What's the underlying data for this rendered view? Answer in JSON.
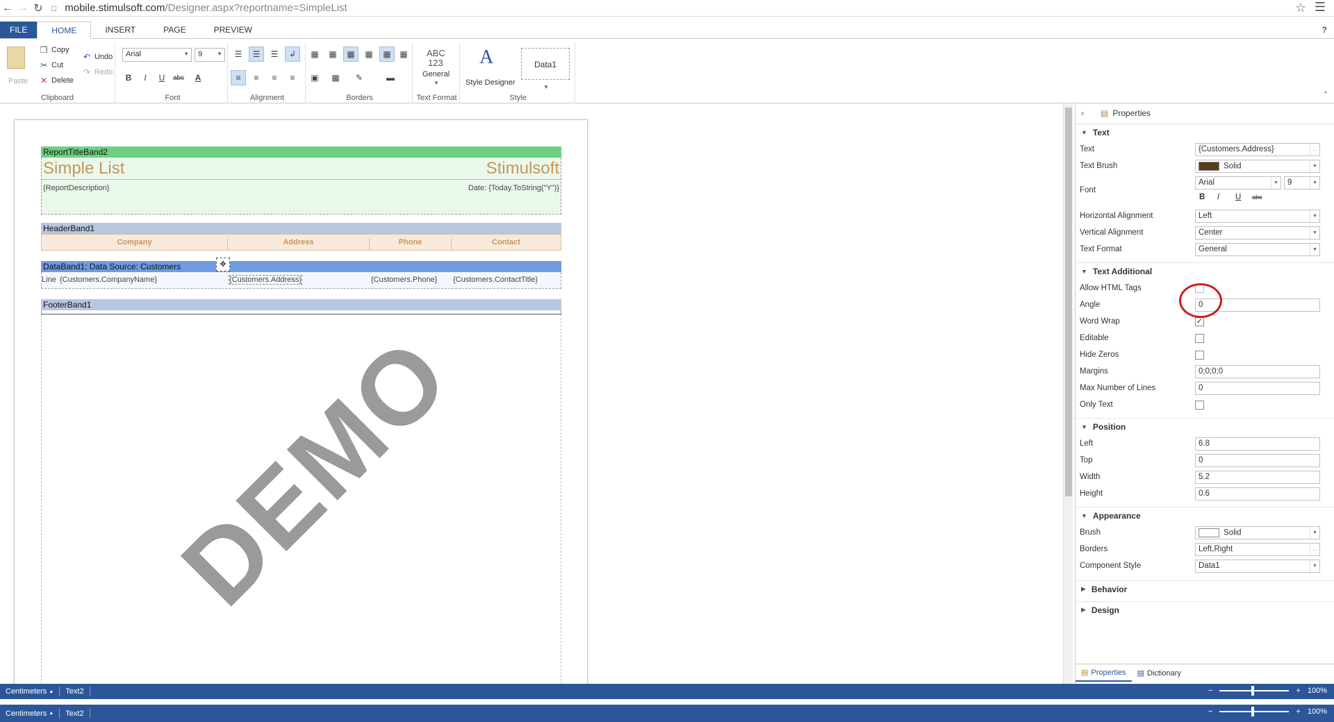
{
  "browser": {
    "url_host": "mobile.stimulsoft.com",
    "url_path": "/Designer.aspx?reportname=SimpleList"
  },
  "ribbon_tabs": [
    "FILE",
    "HOME",
    "INSERT",
    "PAGE",
    "PREVIEW"
  ],
  "active_tab": "HOME",
  "help": "?",
  "clipboard": {
    "paste": "Paste",
    "copy": "Copy",
    "cut": "Cut",
    "delete": "Delete",
    "undo": "Undo",
    "redo": "Redo",
    "label": "Clipboard"
  },
  "font_group": {
    "font_name": "Arial",
    "font_size": "9",
    "label": "Font",
    "bold": "B",
    "italic": "I",
    "underline": "U",
    "strike": "abc",
    "color": "A"
  },
  "alignment_label": "Alignment",
  "borders_label": "Borders",
  "text_format": {
    "abc": "ABC",
    "num": "123",
    "general": "General",
    "label": "Text Format"
  },
  "style": {
    "designer": "Style Designer",
    "data1": "Data1",
    "label": "Style"
  },
  "report": {
    "title_band": "ReportTitleBand2",
    "title_left": "Simple List",
    "title_right": "Stimulsoft",
    "description": "{ReportDescription}",
    "date": "Date: {Today.ToString(\"Y\")}",
    "header_band": "HeaderBand1",
    "columns": [
      "Company",
      "Address",
      "Phone",
      "Contact"
    ],
    "data_band": "DataBand1; Data Source: Customers",
    "line": "Line",
    "fields": [
      "{Customers.CompanyName}",
      "{Customers.Address}",
      "{Customers.Phone}",
      "{Customers.ContactTitle}"
    ],
    "footer_band": "FooterBand1",
    "watermark": "DEMO"
  },
  "properties": {
    "header": "Properties",
    "text_cat": "Text",
    "text_label": "Text",
    "text_value": "{Customers.Address}",
    "text_brush_label": "Text Brush",
    "text_brush_value": "Solid",
    "text_brush_color": "#5a3e1b",
    "font_label": "Font",
    "font_name": "Arial",
    "font_size": "9",
    "halign_label": "Horizontal Alignment",
    "halign_value": "Left",
    "valign_label": "Vertical Alignment",
    "valign_value": "Center",
    "textformat_label": "Text Format",
    "textformat_value": "General",
    "text_additional_cat": "Text Additional",
    "allow_html_label": "Allow HTML Tags",
    "angle_label": "Angle",
    "angle_value": "0",
    "word_wrap_label": "Word Wrap",
    "editable_label": "Editable",
    "hide_zeros_label": "Hide Zeros",
    "margins_label": "Margins",
    "margins_value": "0;0;0;0",
    "max_lines_label": "Max Number of Lines",
    "max_lines_value": "0",
    "only_text_label": "Only Text",
    "position_cat": "Position",
    "left_label": "Left",
    "left_value": "6.8",
    "top_label": "Top",
    "top_value": "0",
    "width_label": "Width",
    "width_value": "5.2",
    "height_label": "Height",
    "height_value": "0.6",
    "appearance_cat": "Appearance",
    "brush_label": "Brush",
    "brush_value": "Solid",
    "borders_label": "Borders",
    "borders_value": "Left,Right",
    "component_style_label": "Component Style",
    "component_style_value": "Data1",
    "behavior_cat": "Behavior",
    "design_cat": "Design",
    "tab_properties": "Properties",
    "tab_dictionary": "Dictionary"
  },
  "status": {
    "units": "Centimeters",
    "component": "Text2",
    "zoom": "100%"
  },
  "colors": {
    "accent": "#2b579a",
    "title_band": "#6fd07f",
    "header_band": "#b8c6e0",
    "data_band": "#6f9be0",
    "header_cell": "#f7eadb",
    "title_text": "#c8955a"
  }
}
